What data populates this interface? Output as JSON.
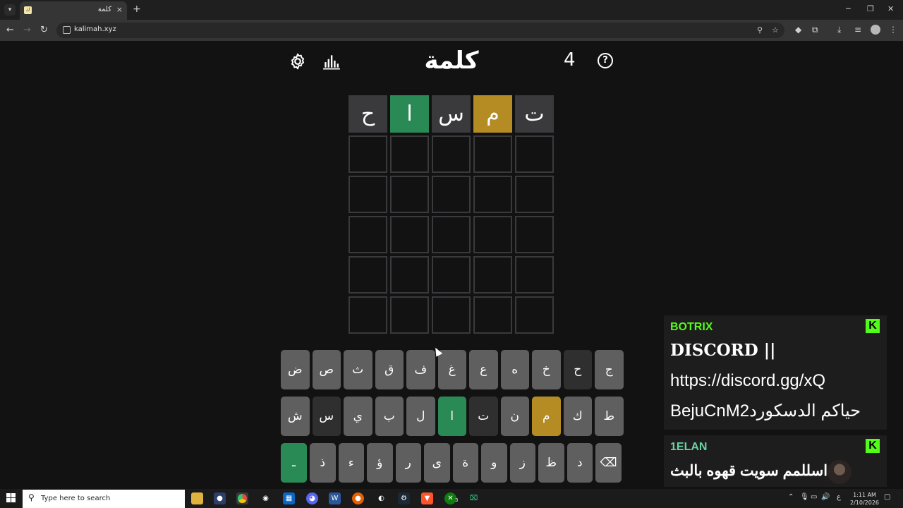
{
  "browser": {
    "tab_title": "كلمة",
    "url": "kalimah.xyz",
    "new_tab_label": "+",
    "tab_close_label": "×"
  },
  "game": {
    "title": "كلمة",
    "streak_count": "4",
    "help_label": "?",
    "board": [
      [
        {
          "letter": "ح",
          "state": "absent"
        },
        {
          "letter": "ا",
          "state": "correct"
        },
        {
          "letter": "س",
          "state": "absent"
        },
        {
          "letter": "م",
          "state": "present"
        },
        {
          "letter": "ت",
          "state": "absent"
        }
      ],
      [
        {
          "letter": "",
          "state": "empty"
        },
        {
          "letter": "",
          "state": "empty"
        },
        {
          "letter": "",
          "state": "empty"
        },
        {
          "letter": "",
          "state": "empty"
        },
        {
          "letter": "",
          "state": "empty"
        }
      ],
      [
        {
          "letter": "",
          "state": "empty"
        },
        {
          "letter": "",
          "state": "empty"
        },
        {
          "letter": "",
          "state": "empty"
        },
        {
          "letter": "",
          "state": "empty"
        },
        {
          "letter": "",
          "state": "empty"
        }
      ],
      [
        {
          "letter": "",
          "state": "empty"
        },
        {
          "letter": "",
          "state": "empty"
        },
        {
          "letter": "",
          "state": "empty"
        },
        {
          "letter": "",
          "state": "empty"
        },
        {
          "letter": "",
          "state": "empty"
        }
      ],
      [
        {
          "letter": "",
          "state": "empty"
        },
        {
          "letter": "",
          "state": "empty"
        },
        {
          "letter": "",
          "state": "empty"
        },
        {
          "letter": "",
          "state": "empty"
        },
        {
          "letter": "",
          "state": "empty"
        }
      ],
      [
        {
          "letter": "",
          "state": "empty"
        },
        {
          "letter": "",
          "state": "empty"
        },
        {
          "letter": "",
          "state": "empty"
        },
        {
          "letter": "",
          "state": "empty"
        },
        {
          "letter": "",
          "state": "empty"
        }
      ]
    ],
    "keyboard": {
      "row1": [
        {
          "key": "ض",
          "state": "unused"
        },
        {
          "key": "ص",
          "state": "unused"
        },
        {
          "key": "ث",
          "state": "unused"
        },
        {
          "key": "ق",
          "state": "unused"
        },
        {
          "key": "ف",
          "state": "unused"
        },
        {
          "key": "غ",
          "state": "unused"
        },
        {
          "key": "ع",
          "state": "unused"
        },
        {
          "key": "ه",
          "state": "unused"
        },
        {
          "key": "خ",
          "state": "unused"
        },
        {
          "key": "ح",
          "state": "absent"
        },
        {
          "key": "ج",
          "state": "unused"
        }
      ],
      "row2": [
        {
          "key": "ش",
          "state": "unused"
        },
        {
          "key": "س",
          "state": "absent"
        },
        {
          "key": "ي",
          "state": "unused"
        },
        {
          "key": "ب",
          "state": "unused"
        },
        {
          "key": "ل",
          "state": "unused"
        },
        {
          "key": "ا",
          "state": "correct"
        },
        {
          "key": "ت",
          "state": "absent"
        },
        {
          "key": "ن",
          "state": "unused"
        },
        {
          "key": "م",
          "state": "present"
        },
        {
          "key": "ك",
          "state": "unused"
        },
        {
          "key": "ط",
          "state": "unused"
        }
      ],
      "row3": [
        {
          "key": "ـ",
          "state": "enter"
        },
        {
          "key": "ذ",
          "state": "unused"
        },
        {
          "key": "ء",
          "state": "unused"
        },
        {
          "key": "ؤ",
          "state": "unused"
        },
        {
          "key": "ر",
          "state": "unused"
        },
        {
          "key": "ى",
          "state": "unused"
        },
        {
          "key": "ة",
          "state": "unused"
        },
        {
          "key": "و",
          "state": "unused"
        },
        {
          "key": "ز",
          "state": "unused"
        },
        {
          "key": "ظ",
          "state": "unused"
        },
        {
          "key": "د",
          "state": "unused"
        },
        {
          "key": "⌫",
          "state": "backspace"
        }
      ]
    },
    "colors": {
      "correct": "#2a8a55",
      "present": "#b58c24",
      "absent": "#3a3a3c"
    }
  },
  "chat": [
    {
      "user": "BOTRIX",
      "lines": [
        "DISCORD ||",
        "https://discord.gg/xQ",
        "BejuCnM2حياكم الدسكورد"
      ]
    },
    {
      "user": "1ELAN",
      "lines": [
        "اسللمم سويت قهوه بالبث"
      ]
    }
  ],
  "taskbar": {
    "search_placeholder": "Type here to search",
    "time": "1:11 AM",
    "date": "2/10/2026",
    "lang": "ع",
    "badge": "3"
  }
}
